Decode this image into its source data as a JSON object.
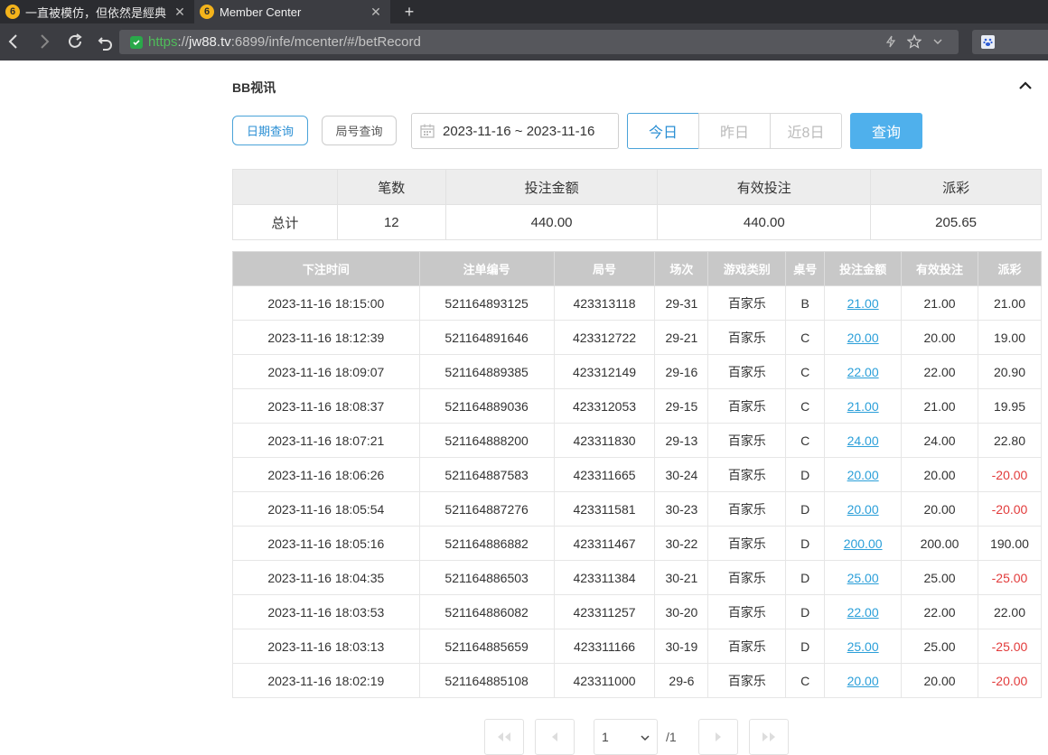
{
  "browser": {
    "tabs": [
      {
        "title": "一直被模仿，但依然是經典",
        "favicon": "6",
        "active": false
      },
      {
        "title": "Member Center",
        "favicon": "6",
        "active": true
      }
    ],
    "url": {
      "protocol": "https",
      "sep": "://",
      "host": "jw88.tv",
      "rest": ":6899/infe/mcenter/#/betRecord"
    }
  },
  "page": {
    "title": "BB视讯",
    "query_by_date": "日期查询",
    "query_by_round": "局号查询",
    "date_range": "2023-11-16 ~ 2023-11-16",
    "quick_ranges": [
      "今日",
      "昨日",
      "近8日"
    ],
    "search_label": "查询"
  },
  "summary": {
    "headers": [
      "",
      "笔数",
      "投注金额",
      "有效投注",
      "派彩"
    ],
    "row": [
      "总计",
      "12",
      "440.00",
      "440.00",
      "205.65"
    ]
  },
  "records": {
    "headers": [
      "下注时间",
      "注单编号",
      "局号",
      "场次",
      "游戏类别",
      "桌号",
      "投注金额",
      "有效投注",
      "派彩"
    ],
    "rows": [
      [
        "2023-11-16 18:15:00",
        "521164893125",
        "423313118",
        "29-31",
        "百家乐",
        "B",
        "21.00",
        "21.00",
        "21.00"
      ],
      [
        "2023-11-16 18:12:39",
        "521164891646",
        "423312722",
        "29-21",
        "百家乐",
        "C",
        "20.00",
        "20.00",
        "19.00"
      ],
      [
        "2023-11-16 18:09:07",
        "521164889385",
        "423312149",
        "29-16",
        "百家乐",
        "C",
        "22.00",
        "22.00",
        "20.90"
      ],
      [
        "2023-11-16 18:08:37",
        "521164889036",
        "423312053",
        "29-15",
        "百家乐",
        "C",
        "21.00",
        "21.00",
        "19.95"
      ],
      [
        "2023-11-16 18:07:21",
        "521164888200",
        "423311830",
        "29-13",
        "百家乐",
        "C",
        "24.00",
        "24.00",
        "22.80"
      ],
      [
        "2023-11-16 18:06:26",
        "521164887583",
        "423311665",
        "30-24",
        "百家乐",
        "D",
        "20.00",
        "20.00",
        "-20.00"
      ],
      [
        "2023-11-16 18:05:54",
        "521164887276",
        "423311581",
        "30-23",
        "百家乐",
        "D",
        "20.00",
        "20.00",
        "-20.00"
      ],
      [
        "2023-11-16 18:05:16",
        "521164886882",
        "423311467",
        "30-22",
        "百家乐",
        "D",
        "200.00",
        "200.00",
        "190.00"
      ],
      [
        "2023-11-16 18:04:35",
        "521164886503",
        "423311384",
        "30-21",
        "百家乐",
        "D",
        "25.00",
        "25.00",
        "-25.00"
      ],
      [
        "2023-11-16 18:03:53",
        "521164886082",
        "423311257",
        "30-20",
        "百家乐",
        "D",
        "22.00",
        "22.00",
        "22.00"
      ],
      [
        "2023-11-16 18:03:13",
        "521164885659",
        "423311166",
        "30-19",
        "百家乐",
        "D",
        "25.00",
        "25.00",
        "-25.00"
      ],
      [
        "2023-11-16 18:02:19",
        "521164885108",
        "423311000",
        "29-6",
        "百家乐",
        "C",
        "20.00",
        "20.00",
        "-20.00"
      ]
    ]
  },
  "pagination": {
    "current_page": "1",
    "total": "/1"
  },
  "colors": {
    "accent": "#4fb0ec",
    "link": "#2b9fd9",
    "negative": "#e23b3b",
    "header_bg": "#c8c8c8"
  }
}
